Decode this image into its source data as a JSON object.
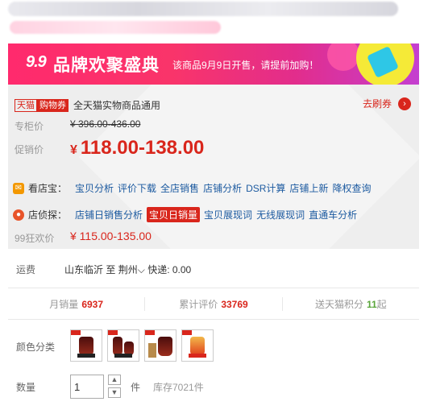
{
  "banner": {
    "logo": "9.9",
    "brand": "品牌欢聚盛典",
    "notice": "该商品9月9日开售，请提前加购！"
  },
  "coupon": {
    "tag_tmall": "天猫",
    "tag_shop": "购物券",
    "text": "全天猫实物商品通用",
    "action": "去刷券",
    "action_icon": "chevron-right-icon"
  },
  "price": {
    "counter_label": "专柜价",
    "counter_value": "¥ 396.00-436.00",
    "promo_label": "促销价",
    "promo_currency": "¥",
    "promo_value": "118.00-138.00"
  },
  "shop_treasure": {
    "name": "看店宝：",
    "icon": "envelope-icon",
    "icon_color": "#f39800",
    "links": [
      "宝贝分析",
      "评价下载",
      "全店销售",
      "店铺分析",
      "DSR计算",
      "店铺上新",
      "降权查询"
    ]
  },
  "shop_detective": {
    "name": "店侦探：",
    "icon": "person-icon",
    "icon_color": "#e8542a",
    "links": [
      "店铺日销售分析",
      "宝贝日销量",
      "宝贝展现词",
      "无线展现词",
      "直通车分析"
    ],
    "active_index": 1
  },
  "double_nine": {
    "label": "99狂欢价",
    "value": "¥ 115.00-135.00"
  },
  "shipping": {
    "label": "运费",
    "origin": "山东临沂",
    "to": "至",
    "destination": "荆州",
    "express": "快递: 0.00"
  },
  "stats": {
    "monthly_label": "月销量",
    "monthly_value": "6937",
    "reviews_label": "累计评价",
    "reviews_value": "33769",
    "points_label": "送天猫积分",
    "points_value": "11",
    "points_suffix": "起"
  },
  "colors": {
    "label": "颜色分类",
    "options": [
      "option-1",
      "option-2",
      "option-3",
      "option-4"
    ]
  },
  "quantity": {
    "label": "数量",
    "value": "1",
    "unit": "件",
    "stock": "库存7021件"
  },
  "theme": {
    "accent": "#d9261c",
    "link": "#1c5aa0",
    "banner_start": "#ff2a6d",
    "banner_end": "#c43fd0"
  }
}
